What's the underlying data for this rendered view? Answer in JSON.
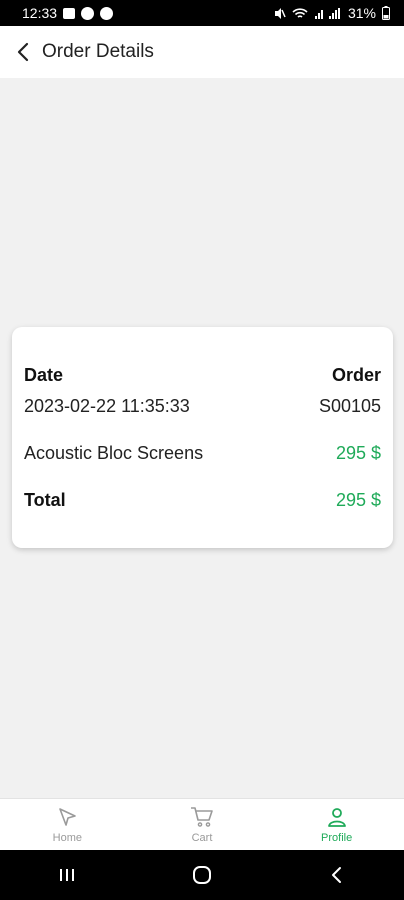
{
  "status_bar": {
    "time": "12:33",
    "battery": "31%"
  },
  "header": {
    "title": "Order Details"
  },
  "order": {
    "date_label": "Date",
    "order_label": "Order",
    "date_value": "2023-02-22 11:35:33",
    "order_value": "S00105",
    "item_name": "Acoustic Bloc Screens",
    "item_price": "295 $",
    "total_label": "Total",
    "total_value": "295 $"
  },
  "bottom_nav": {
    "items": [
      {
        "label": "Home",
        "icon": "cursor-arrow-icon"
      },
      {
        "label": "Cart",
        "icon": "cart-icon"
      },
      {
        "label": "Profile",
        "icon": "person-icon"
      }
    ],
    "active_index": 2
  },
  "colors": {
    "accent": "#1faa59",
    "background": "#f1f1f1"
  }
}
